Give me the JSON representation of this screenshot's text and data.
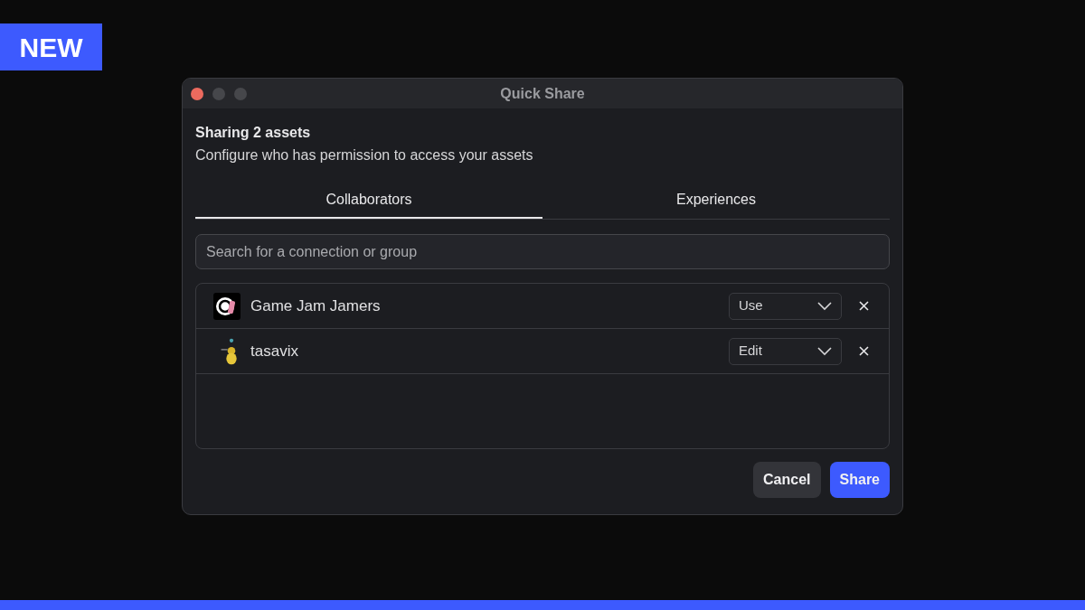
{
  "badge": "NEW",
  "window": {
    "title": "Quick Share"
  },
  "heading": "Sharing 2 assets",
  "subtitle": "Configure who has permission to access your assets",
  "tabs": [
    {
      "label": "Collaborators",
      "selected": true
    },
    {
      "label": "Experiences",
      "selected": false
    }
  ],
  "search": {
    "placeholder": "Search for a connection or group"
  },
  "collaborators": [
    {
      "kind": "group",
      "name": "Game Jam Jamers",
      "permission": "Use"
    },
    {
      "kind": "user",
      "name": "tasavix",
      "permission": "Edit"
    }
  ],
  "buttons": [
    {
      "label": "Cancel",
      "kind": "secondary"
    },
    {
      "label": "Share",
      "kind": "primary"
    }
  ]
}
